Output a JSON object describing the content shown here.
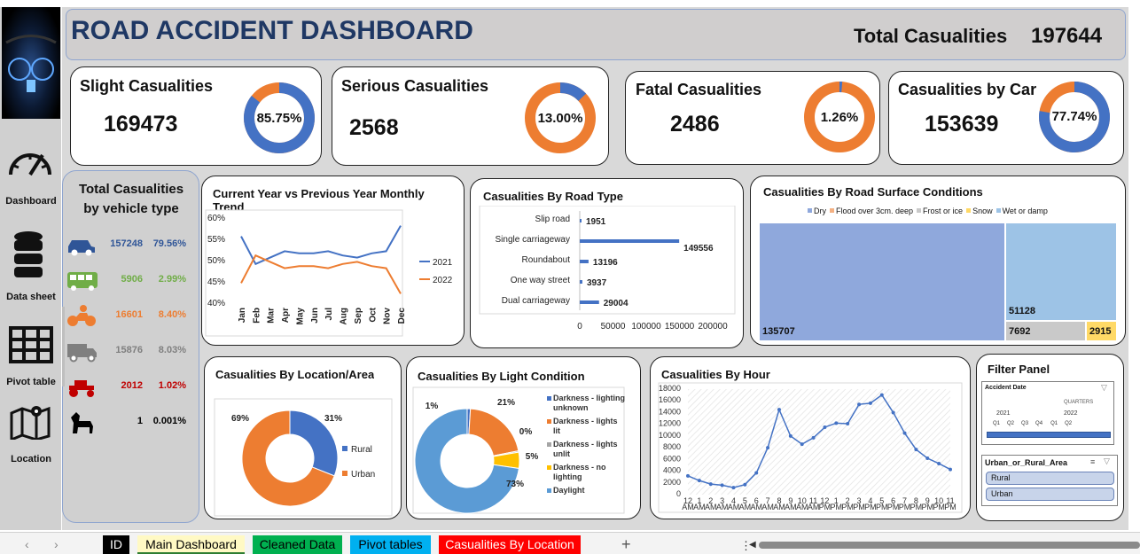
{
  "header": {
    "title": "ROAD ACCIDENT DASHBOARD",
    "total_label": "Total Casualities",
    "total_value": "197644"
  },
  "kpis": [
    {
      "title": "Slight Casualities",
      "value": "169473",
      "pct_label": "85.75%",
      "pct": 0.8575
    },
    {
      "title": "Serious Casualities",
      "value": "2568",
      "pct_label": "13.00%",
      "pct": 0.13
    },
    {
      "title": "Fatal Casualities",
      "value": "2486",
      "pct_label": "1.26%",
      "pct": 0.0126
    },
    {
      "title": "Casualities by Car",
      "value": "153639",
      "pct_label": "77.74%",
      "pct": 0.7774
    }
  ],
  "nav": {
    "dashboard": "Dashboard",
    "data_sheet": "Data sheet",
    "pivot_table": "Pivot table",
    "location": "Location"
  },
  "vehicle": {
    "title1": "Total Casualities",
    "title2": "by vehicle type",
    "rows": [
      {
        "icon": "car-icon",
        "value": "157248",
        "pct": "79.56%",
        "color": "#2f5597"
      },
      {
        "icon": "bus-icon",
        "value": "5906",
        "pct": "2.99%",
        "color": "#70ad47"
      },
      {
        "icon": "motorcycle-icon",
        "value": "16601",
        "pct": "8.40%",
        "color": "#ed7d31"
      },
      {
        "icon": "truck-icon",
        "value": "15876",
        "pct": "8.03%",
        "color": "#7f7f7f"
      },
      {
        "icon": "tractor-icon",
        "value": "2012",
        "pct": "1.02%",
        "color": "#c00000"
      },
      {
        "icon": "horse-icon",
        "value": "1",
        "pct": "0.001%",
        "color": "#000000"
      }
    ]
  },
  "chart_data": [
    {
      "type": "line",
      "title": "Current Year vs Previous Year Monthly Trend",
      "categories": [
        "Jan",
        "Feb",
        "Mar",
        "Apr",
        "May",
        "Jun",
        "Jul",
        "Aug",
        "Sep",
        "Oct",
        "Nov",
        "Dec"
      ],
      "yticks": [
        "60%",
        "55%",
        "50%",
        "45%",
        "40%"
      ],
      "ylim": [
        40,
        60
      ],
      "series": [
        {
          "name": "2021",
          "color": "#4472c4",
          "values": [
            55.5,
            49,
            50.5,
            52,
            51.5,
            51.5,
            52,
            51,
            50.5,
            51.5,
            52,
            58
          ]
        },
        {
          "name": "2022",
          "color": "#ed7d31",
          "values": [
            44.5,
            51,
            49.5,
            48,
            48.5,
            48.5,
            48,
            49,
            49.5,
            48.5,
            48,
            42
          ]
        }
      ]
    },
    {
      "type": "bar",
      "title": "Casualities By Road Type",
      "categories": [
        "Slip road",
        "Single carriageway",
        "Roundabout",
        "One way street",
        "Dual carriageway"
      ],
      "values": [
        1951,
        149556,
        13196,
        3937,
        29004
      ],
      "xlim": [
        0,
        200000
      ],
      "xticks": [
        "0",
        "50000",
        "100000",
        "150000",
        "200000"
      ]
    },
    {
      "type": "treemap",
      "title": "Casualities By Road Surface Conditions",
      "legend": [
        "Dry",
        "Flood over 3cm. deep",
        "Frost or ice",
        "Snow",
        "Wet or damp"
      ],
      "values": [
        {
          "name": "Dry",
          "value": 135707,
          "label": "135707"
        },
        {
          "name": "Wet or damp",
          "value": 51128,
          "label": "51128"
        },
        {
          "name": "Frost or ice",
          "value": 7692,
          "label": "7692"
        },
        {
          "name": "Snow",
          "value": 2915,
          "label": "2915"
        }
      ]
    },
    {
      "type": "pie",
      "title": "Casualities By Location/Area",
      "values": [
        {
          "name": "Rural",
          "pct": 31,
          "label": "31%",
          "color": "#4472c4"
        },
        {
          "name": "Urban",
          "pct": 69,
          "label": "69%",
          "color": "#ed7d31"
        }
      ]
    },
    {
      "type": "pie",
      "title": "Casualities By Light Condition",
      "values": [
        {
          "name": "Darkness - lighting unknown",
          "pct": 1,
          "label": "1%",
          "color": "#4472c4"
        },
        {
          "name": "Darkness - lights lit",
          "pct": 21,
          "label": "21%",
          "color": "#ed7d31"
        },
        {
          "name": "Darkness - lights unlit",
          "pct": 0.4,
          "label": "0%",
          "color": "#a5a5a5"
        },
        {
          "name": "Darkness - no lighting",
          "pct": 5,
          "label": "5%",
          "color": "#ffc000"
        },
        {
          "name": "Daylight",
          "pct": 73,
          "label": "73%",
          "color": "#5b9bd5"
        }
      ]
    },
    {
      "type": "line",
      "title": "Casualities By Hour",
      "yticks": [
        "18000",
        "16000",
        "14000",
        "12000",
        "10000",
        "8000",
        "6000",
        "4000",
        "2000",
        "0"
      ],
      "ylim": [
        0,
        18000
      ],
      "x_hours": [
        "12",
        "1",
        "2",
        "3",
        "4",
        "5",
        "6",
        "7",
        "8",
        "9",
        "10",
        "11",
        "12",
        "1",
        "2",
        "3",
        "4",
        "5",
        "6",
        "7",
        "8",
        "9",
        "10",
        "11"
      ],
      "x_ampm": [
        "AM",
        "AM",
        "AM",
        "AM",
        "AM",
        "AM",
        "AM",
        "AM",
        "AM",
        "AM",
        "AM",
        "AM",
        "PM",
        "PM",
        "PM",
        "PM",
        "PM",
        "PM",
        "PM",
        "PM",
        "PM",
        "PM",
        "PM",
        "PM"
      ],
      "values": [
        3200,
        2400,
        1800,
        1600,
        1200,
        1700,
        3700,
        8000,
        14500,
        10000,
        8600,
        9700,
        11500,
        12200,
        12100,
        15400,
        15600,
        17000,
        14000,
        10500,
        7700,
        6200,
        5300,
        4300
      ]
    }
  ],
  "filter": {
    "title": "Filter Panel",
    "date_label": "Accident Date",
    "quarters_label": "QUARTERS",
    "years": [
      "2021",
      "2022"
    ],
    "quarters": [
      "Q1",
      "Q2",
      "Q3",
      "Q4",
      "Q1",
      "Q2"
    ],
    "area_label": "Urban_or_Rural_Area",
    "area_options": [
      "Rural",
      "Urban"
    ]
  },
  "tabs": [
    "ID",
    "Main Dashboard",
    "Cleaned Data",
    "Pivot tables",
    "Casualities By Location"
  ],
  "colors": {
    "blue": "#4472c4",
    "orange": "#ed7d31",
    "lightblue": "#5b9bd5",
    "grey": "#a5a5a5",
    "yellow": "#ffc000"
  }
}
